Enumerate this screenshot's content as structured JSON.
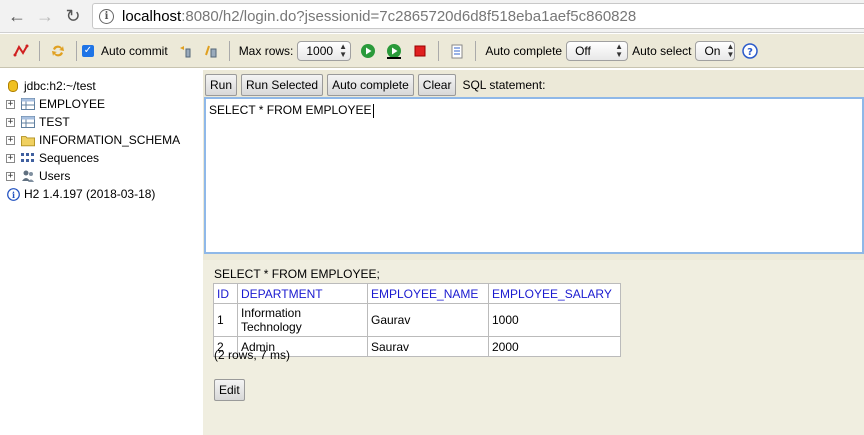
{
  "browser": {
    "url_host": "localhost",
    "url_rest": ":8080/h2/login.do?jsessionid=7c2865720d6d8f518eba1aef5c860828"
  },
  "toolbar": {
    "auto_commit_label": "Auto commit",
    "max_rows_label": "Max rows:",
    "max_rows_value": "1000",
    "auto_complete_label": "Auto complete",
    "auto_complete_value": "Off",
    "auto_select_label": "Auto select",
    "auto_select_value": "On"
  },
  "tree": {
    "connection": "jdbc:h2:~/test",
    "items": [
      {
        "label": "EMPLOYEE",
        "icon": "table-icon"
      },
      {
        "label": "TEST",
        "icon": "table-icon"
      },
      {
        "label": "INFORMATION_SCHEMA",
        "icon": "folder-icon"
      },
      {
        "label": "Sequences",
        "icon": "sequences-icon"
      },
      {
        "label": "Users",
        "icon": "users-icon"
      }
    ],
    "version": "H2 1.4.197 (2018-03-18)"
  },
  "sql": {
    "run_label": "Run",
    "run_selected_label": "Run Selected",
    "auto_complete_label": "Auto complete",
    "clear_label": "Clear",
    "statement_label": "SQL statement:",
    "editor_text": "SELECT * FROM EMPLOYEE"
  },
  "result": {
    "query": "SELECT * FROM EMPLOYEE;",
    "columns": [
      "ID",
      "DEPARTMENT",
      "EMPLOYEE_NAME",
      "EMPLOYEE_SALARY"
    ],
    "rows": [
      [
        "1",
        "Information Technology",
        "Gaurav",
        "1000"
      ],
      [
        "2",
        "Admin",
        "Saurav",
        "2000"
      ]
    ],
    "status": "(2 rows, 7 ms)",
    "edit_label": "Edit"
  }
}
